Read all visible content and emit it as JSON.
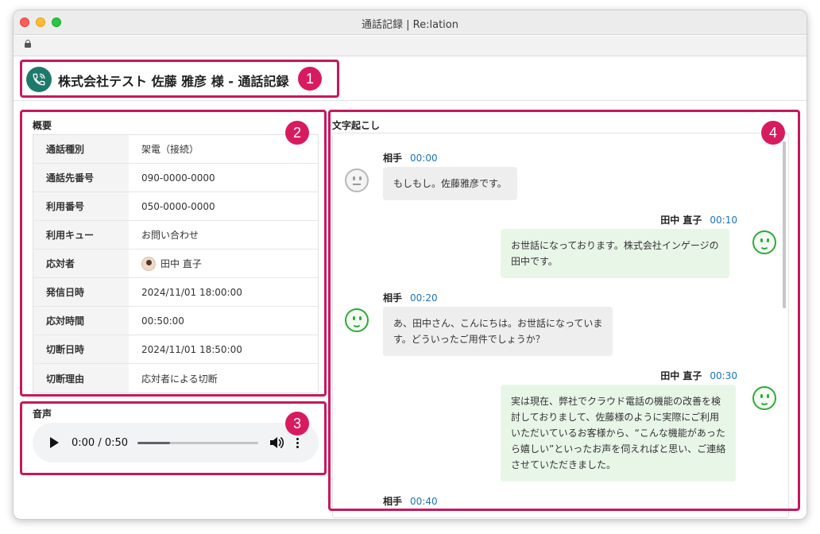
{
  "window": {
    "title": "通話記録 | Re:lation"
  },
  "header": {
    "title": "株式会社テスト  佐藤 雅彦  様 - 通話記録"
  },
  "badges": [
    "1",
    "2",
    "3",
    "4"
  ],
  "overview": {
    "label": "概要",
    "rows": [
      {
        "key": "通話種別",
        "value": "架電（接続）"
      },
      {
        "key": "通話先番号",
        "value": "090-0000-0000"
      },
      {
        "key": "利用番号",
        "value": "050-0000-0000"
      },
      {
        "key": "利用キュー",
        "value": "お問い合わせ"
      },
      {
        "key": "応対者",
        "value": "田中 直子"
      },
      {
        "key": "発信日時",
        "value": "2024/11/01 18:00:00"
      },
      {
        "key": "応対時間",
        "value": "00:50:00"
      },
      {
        "key": "切断日時",
        "value": "2024/11/01 18:50:00"
      },
      {
        "key": "切断理由",
        "value": "応対者による切断"
      }
    ]
  },
  "audio": {
    "label": "音声",
    "time": "0:00 / 0:50",
    "progress_fraction": 0.27
  },
  "transcript": {
    "label": "文字起こし",
    "messages": [
      {
        "speaker": "相手",
        "time": "00:00",
        "side": "them",
        "sentiment": "neutral",
        "lines": [
          "もしもし。佐藤雅彦です。"
        ]
      },
      {
        "speaker": "田中 直子",
        "time": "00:10",
        "side": "me",
        "sentiment": "happy",
        "lines": [
          "お世話になっております。株式会社インゲージの",
          "田中です。"
        ]
      },
      {
        "speaker": "相手",
        "time": "00:20",
        "side": "them",
        "sentiment": "happy",
        "lines": [
          "あ、田中さん、こんにちは。お世話になっていま",
          "す。どういったご用件でしょうか？"
        ]
      },
      {
        "speaker": "田中 直子",
        "time": "00:30",
        "side": "me",
        "sentiment": "happy",
        "lines": [
          "実は現在、弊社でクラウド電話の機能の改善を検",
          "討しておりまして、佐藤様のように実際にご利用",
          "いただいているお客様から、“こんな機能があった",
          "ら嬉しい”といったお声を伺えればと思い、ご連絡",
          "させていただきました。"
        ]
      },
      {
        "speaker": "相手",
        "time": "00:40",
        "side": "them",
        "sentiment": "",
        "lines": []
      }
    ]
  },
  "colors": {
    "accent": "#c8175d",
    "badge": "#d81b60",
    "phone": "#1d7a6a",
    "timestamp": "#1a73b8"
  }
}
